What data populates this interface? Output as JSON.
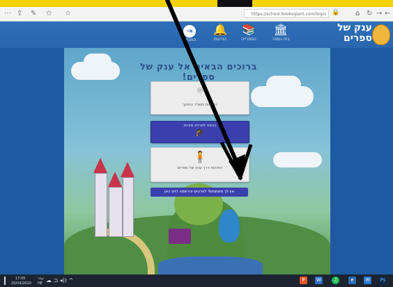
{
  "browser": {
    "url": "https://school.booksgiant.com/login",
    "icons": {
      "more": "⋯",
      "share": "⇪",
      "pen": "✎",
      "favorites": "✩",
      "favorite": "☆",
      "lock": "🔒",
      "home": "⌂",
      "refresh": "↻",
      "forward": "→",
      "back": "←"
    }
  },
  "site": {
    "logo_text": "ענק של ספרים",
    "nav": [
      {
        "icon": "⇥",
        "label": "התנתק"
      },
      {
        "icon": "🔔",
        "label": "הודעות"
      },
      {
        "icon": "📚",
        "label": "הספרייה"
      },
      {
        "icon": "🏛",
        "label": "בית הספר"
      }
    ]
  },
  "main": {
    "welcome": "ברוכים הבאים אל ענק של ספרים!",
    "cards": {
      "ministry_label": "הזדהות משרד החינוך",
      "ministry_icon": "⌾",
      "student_label": "כניסה לפרויה מורות",
      "student_icon": "🎓",
      "guide_label": "הזדהות דרך ענק של ספרים",
      "guide_icon": "🧍"
    },
    "no_login": "אין לך משתמש? לפרטים והרשמה לחץ כאן"
  },
  "taskbar": {
    "time": "17:05",
    "date": "20/04/2020",
    "lang_top": "עבר",
    "lang_bottom": "HE",
    "tray_icons": "☁ ⊐ ◂)) ^"
  },
  "colors": {
    "banner_yellow": "#f6d100",
    "header_blue": "#2a66ad",
    "button_blue": "#3b3fae",
    "arrow": "#000000"
  }
}
